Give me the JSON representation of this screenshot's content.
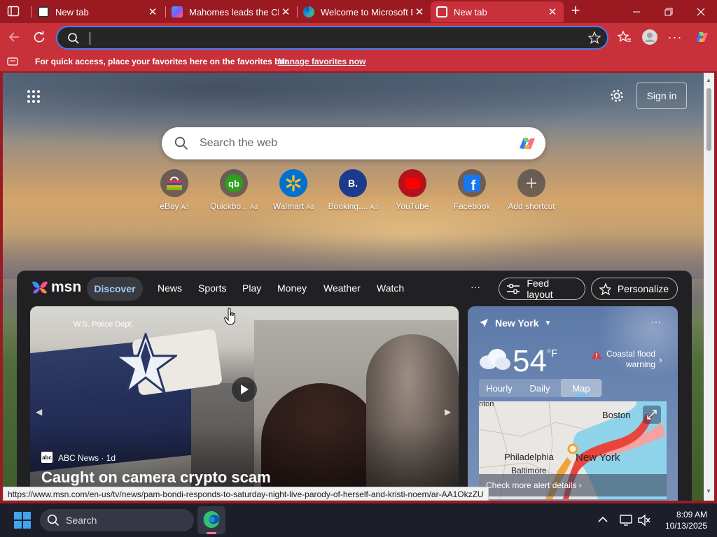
{
  "tabs": [
    {
      "title": "New tab",
      "favicon": "msn-newtab-icon",
      "active": false
    },
    {
      "title": "Mahomes leads the Chi",
      "favicon": "msn-butterfly-icon",
      "active": false
    },
    {
      "title": "Welcome to Microsoft E",
      "favicon": "edge-icon",
      "active": false
    },
    {
      "title": "New tab",
      "favicon": "msn-newtab-icon",
      "active": true
    }
  ],
  "address_bar": {
    "value": "",
    "placeholder": ""
  },
  "favorites_bar": {
    "text": "For quick access, place your favorites here on the favorites bar.",
    "link": "Manage favorites now"
  },
  "newtab": {
    "search_placeholder": "Search the web",
    "sign_in": "Sign in",
    "shortcuts": [
      {
        "label": "eBay",
        "ad": "Ad",
        "icon": "ebay-bag-icon"
      },
      {
        "label": "Quickbo...",
        "ad": "Ad",
        "icon": "quickbooks-icon"
      },
      {
        "label": "Walmart",
        "ad": "Ad",
        "icon": "walmart-spark-icon"
      },
      {
        "label": "Booking....",
        "ad": "Ad",
        "icon": "booking-icon"
      },
      {
        "label": "YouTube",
        "ad": "",
        "icon": "youtube-icon"
      },
      {
        "label": "Facebook",
        "ad": "",
        "icon": "facebook-icon"
      },
      {
        "label": "Add shortcut",
        "ad": "",
        "icon": "plus-icon"
      }
    ]
  },
  "msn": {
    "logo": "msn",
    "nav": [
      "Discover",
      "News",
      "Sports",
      "Play",
      "Money",
      "Weather",
      "Watch"
    ],
    "more": "···",
    "feed_layout": "Feed layout",
    "personalize": "Personalize",
    "hero": {
      "overlay_text": "W.S. Police Dept.",
      "source": "ABC News",
      "age": "1d",
      "headline": "Caught on camera crypto scam"
    },
    "weather": {
      "location": "New York",
      "temp": "54",
      "unit": "°F",
      "alert": "Coastal flood warning",
      "tabs": [
        "Hourly",
        "Daily",
        "Map"
      ],
      "active_tab": "Map",
      "map_labels": [
        "nton",
        "Boston",
        "Philadelphia",
        "Baltimore",
        "New York"
      ],
      "alert_link": "Check more alert details"
    }
  },
  "status_url": "https://www.msn.com/en-us/tv/news/pam-bondi-responds-to-saturday-night-live-parody-of-herself-and-kristi-noem/ar-AA1OkzZU",
  "taskbar": {
    "search": "Search",
    "time": "8:09 AM",
    "date": "10/13/2025"
  }
}
